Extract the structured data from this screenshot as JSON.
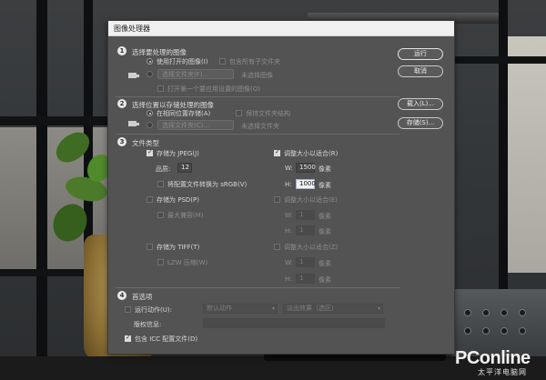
{
  "dialog": {
    "title": "图像处理器",
    "buttons": {
      "run": "运行",
      "cancel": "取消",
      "load": "载入(L)...",
      "save": "存储(S)..."
    },
    "section1": {
      "num": "1",
      "heading": "选择要处理的图像",
      "use_open_images": "使用打开的图像(I)",
      "include_all_subfolders": "包含所有子文件夹",
      "select_folder": "选择文件夹(F)...",
      "folder_status": "未选择图像",
      "open_first_image": "打开第一个要应用设置的图像(O)"
    },
    "section2": {
      "num": "2",
      "heading": "选择位置以存储处理的图像",
      "save_same_location": "在相同位置存储(A)",
      "keep_folder_structure": "保持文件夹结构",
      "select_folder": "选择文件夹(C)...",
      "folder_status": "未选择文件夹"
    },
    "section3": {
      "num": "3",
      "heading": "文件类型",
      "jpeg": {
        "save_as": "存储为 JPEG(J)",
        "resize": "调整大小以适合(R)",
        "quality_label": "品质:",
        "quality_value": "12",
        "convert_srgb": "将配置文件转换为 sRGB(V)",
        "w_label": "W:",
        "w_value": "1500",
        "h_label": "H:",
        "h_value": "1000",
        "unit": "像素"
      },
      "psd": {
        "save_as": "存储为 PSD(P)",
        "resize": "调整大小以适合(E)",
        "max_compat": "最大兼容(M)",
        "w_label": "W:",
        "w_value": "1",
        "h_label": "H:",
        "h_value": "1",
        "unit": "像素"
      },
      "tiff": {
        "save_as": "存储为 TIFF(T)",
        "resize": "调整大小以适合(Z)",
        "lzw": "LZW 压缩(W)",
        "w_label": "W:",
        "w_value": "1",
        "h_label": "H:",
        "h_value": "1",
        "unit": "像素"
      }
    },
    "section4": {
      "num": "4",
      "heading": "首选项",
      "run_action": "运行动作(U):",
      "action_set": "默认动作",
      "action": "淡出效果（选区）",
      "copyright_label": "版权信息:",
      "copyright_value": "",
      "include_icc": "包含 ICC 配置文件(D)"
    }
  },
  "watermark": {
    "brand": "PConline",
    "sub": "太平洋电脑网"
  },
  "colors": {
    "dialog_bg": "#535353",
    "titlebar_bg": "#f0f0f0",
    "focus_field": "#f2f2f2"
  }
}
